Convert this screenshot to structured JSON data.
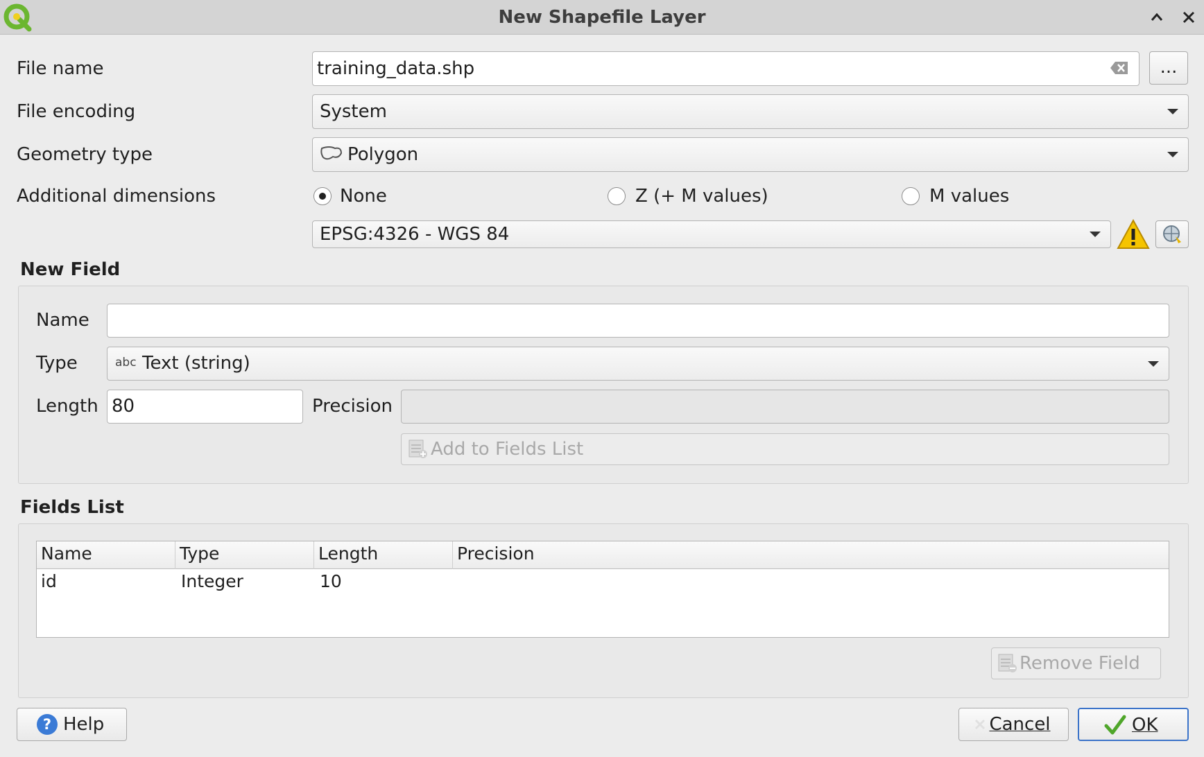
{
  "window": {
    "title": "New Shapefile Layer"
  },
  "form": {
    "file_name_label": "File name",
    "file_name_value": "training_data.shp",
    "browse_label": "...",
    "file_encoding_label": "File encoding",
    "file_encoding_value": "System",
    "geometry_type_label": "Geometry type",
    "geometry_type_value": "Polygon",
    "additional_dimensions_label": "Additional dimensions",
    "dimensions_options": [
      "None",
      "Z (+ M values)",
      "M values"
    ],
    "dimensions_selected": "None",
    "crs_value": "EPSG:4326 - WGS 84"
  },
  "new_field": {
    "heading": "New Field",
    "name_label": "Name",
    "name_value": "",
    "type_label": "Type",
    "type_icon_text": "abc",
    "type_value": "Text (string)",
    "length_label": "Length",
    "length_value": "80",
    "precision_label": "Precision",
    "precision_value": "",
    "add_button_label": "Add to Fields List"
  },
  "fields_list": {
    "heading": "Fields List",
    "columns": [
      "Name",
      "Type",
      "Length",
      "Precision"
    ],
    "rows": [
      [
        "id",
        "Integer",
        "10",
        ""
      ]
    ],
    "remove_button_label": "Remove Field"
  },
  "buttons": {
    "help": "Help",
    "cancel": "Cancel",
    "ok": "OK"
  },
  "colors": {
    "titlebar": "#d4d4d4",
    "background": "#ececec",
    "warning": "#f5c400",
    "qgis_green": "#6bb630",
    "help_blue": "#3b7bd6",
    "ok_border": "#3b73c9"
  }
}
